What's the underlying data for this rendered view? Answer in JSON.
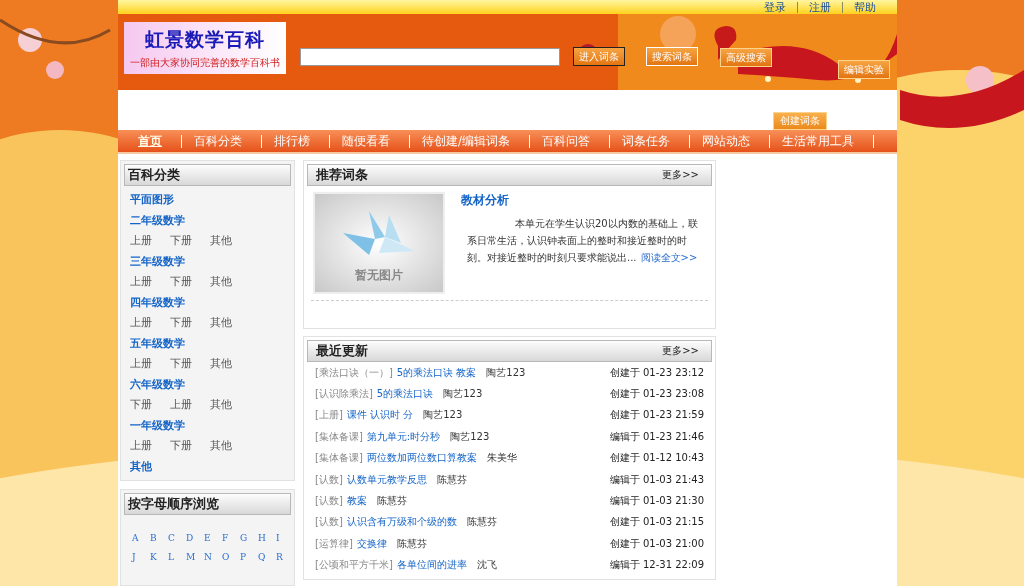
{
  "top_links": [
    "登录",
    "注册",
    "帮助"
  ],
  "logo": {
    "title": "虹景数学百科",
    "subtitle": "一部由大家协同完善的数学百科书"
  },
  "search": {
    "buttons": [
      "进入词条",
      "搜索词条",
      "高级搜索"
    ]
  },
  "edit_button": "编辑实验",
  "create_button": "创建词条",
  "nav": [
    {
      "label": "首页",
      "selected": true
    },
    {
      "label": "百科分类",
      "selected": false
    },
    {
      "label": "排行榜",
      "selected": false
    },
    {
      "label": "随便看看",
      "selected": false
    },
    {
      "label": "待创建/编辑词条",
      "selected": false
    },
    {
      "label": "百科问答",
      "selected": false
    },
    {
      "label": "词条任务",
      "selected": false
    },
    {
      "label": "网站动态",
      "selected": false
    },
    {
      "label": "生活常用工具",
      "selected": false
    }
  ],
  "categories": {
    "title": "百科分类",
    "groups": [
      {
        "name": "平面图形"
      },
      {
        "name": "二年级数学",
        "children": [
          "上册",
          "下册",
          "其他"
        ]
      },
      {
        "name": "三年级数学",
        "children": [
          "上册",
          "下册",
          "其他"
        ]
      },
      {
        "name": "四年级数学",
        "children": [
          "上册",
          "下册",
          "其他"
        ]
      },
      {
        "name": "五年级数学",
        "children": [
          "上册",
          "下册",
          "其他"
        ]
      },
      {
        "name": "六年级数学",
        "children": [
          "下册",
          "上册",
          "其他"
        ]
      },
      {
        "name": "一年级数学",
        "children": [
          "上册",
          "下册",
          "其他"
        ]
      },
      {
        "name": "其他"
      }
    ]
  },
  "alphabet": {
    "title": "按字母顺序浏览",
    "letters": [
      "A",
      "B",
      "C",
      "D",
      "E",
      "F",
      "G",
      "H",
      "I",
      "J",
      "K",
      "L",
      "M",
      "N",
      "O",
      "P",
      "Q",
      "R"
    ]
  },
  "recommended": {
    "title": "推荐词条",
    "more": "更多>>",
    "image_text": "暂无图片",
    "entry_title": "教材分析",
    "summary": "本单元在学生认识20以内数的基础上，联系日常生活，认识钟表面上的整时和接近整时的时刻。对接近整时的时刻只要求能说出...",
    "read_more": "阅读全文>>"
  },
  "recent": {
    "title": "最近更新",
    "more": "更多>>",
    "rows": [
      {
        "category": "[乘法口诀（一）]",
        "entry": "5的乘法口诀 教案",
        "author": "陶艺123",
        "updated": "创建于 01-23 23:12"
      },
      {
        "category": "[认识除乘法]",
        "entry": "5的乘法口诀",
        "author": "陶艺123",
        "updated": "创建于 01-23 23:08"
      },
      {
        "category": "[上册]",
        "entry": "课件 认识时 分",
        "author": "陶艺123",
        "updated": "创建于 01-23 21:59"
      },
      {
        "category": "[集体备课]",
        "entry": "第九单元:时分秒",
        "author": "陶艺123",
        "updated": "编辑于 01-23 21:46"
      },
      {
        "category": "[集体备课]",
        "entry": "两位数加两位数口算教案",
        "author": "朱美华",
        "updated": "创建于 01-12 10:43"
      },
      {
        "category": "[认数]",
        "entry": "认数单元教学反思",
        "author": "陈慧芬",
        "updated": "编辑于 01-03 21:43"
      },
      {
        "category": "[认数]",
        "entry": "教案",
        "author": "陈慧芬",
        "updated": "编辑于 01-03 21:30"
      },
      {
        "category": "[认数]",
        "entry": "认识含有万级和个级的数",
        "author": "陈慧芬",
        "updated": "创建于 01-03 21:15"
      },
      {
        "category": "[运算律]",
        "entry": "交换律",
        "author": "陈慧芬",
        "updated": "创建于 01-03 21:00"
      },
      {
        "category": "[公顷和平方千米]",
        "entry": "各单位间的进率",
        "author": "沈飞",
        "updated": "编辑于 12-31 22:09"
      }
    ]
  }
}
